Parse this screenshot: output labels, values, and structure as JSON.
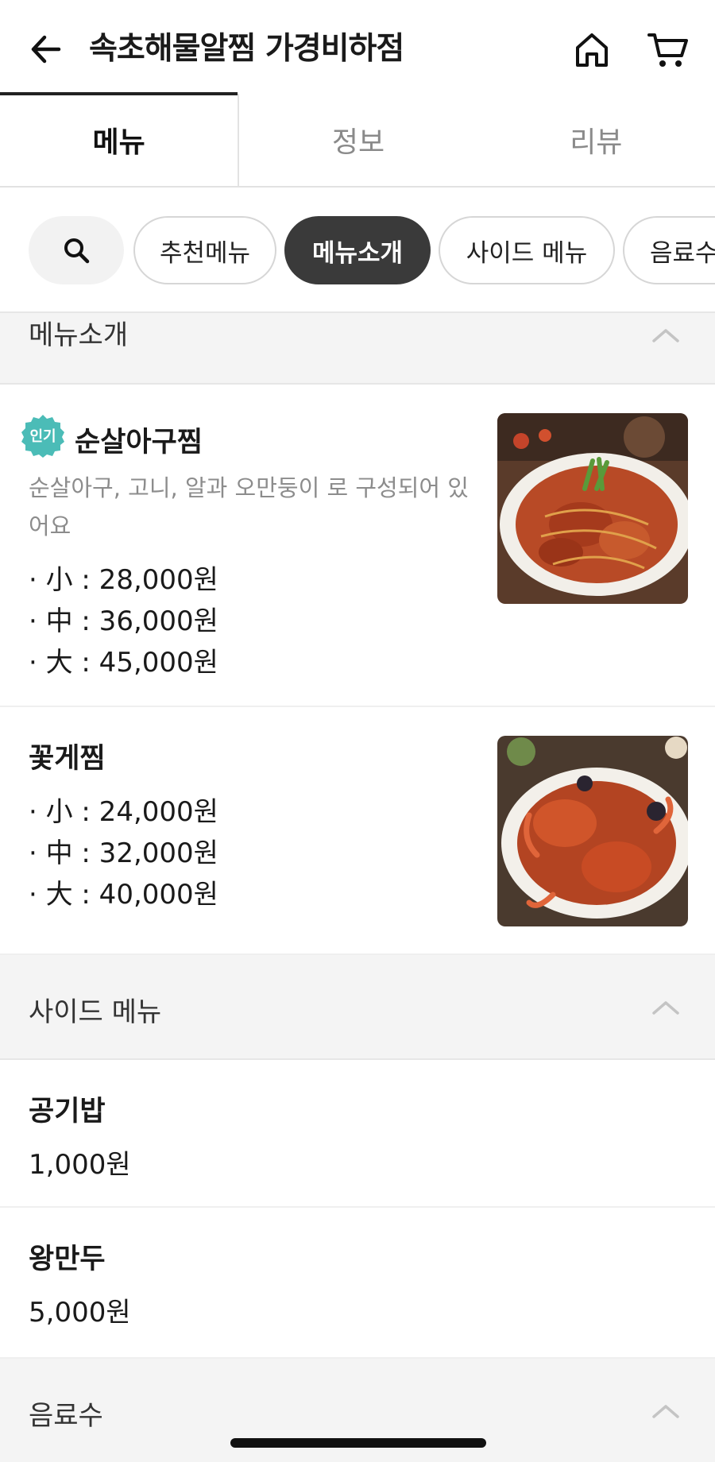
{
  "header": {
    "title": "속초해물알찜 가경비하점"
  },
  "tabs": [
    {
      "label": "메뉴"
    },
    {
      "label": "정보"
    },
    {
      "label": "리뷰"
    }
  ],
  "chips": [
    {
      "label": "추천메뉴"
    },
    {
      "label": "메뉴소개"
    },
    {
      "label": "사이드 메뉴"
    },
    {
      "label": "음료수"
    }
  ],
  "sections": {
    "intro": {
      "title": "메뉴소개"
    },
    "side": {
      "title": "사이드 메뉴"
    },
    "drinks": {
      "title": "음료수"
    }
  },
  "items": {
    "boneless_agu": {
      "badge": "인기",
      "name": "순살아구찜",
      "desc": "순살아구,  고니, 알과 오만둥이 로 구성되어 있어요",
      "prices": [
        "· 小 : 28,000원",
        "· 中 : 36,000원",
        "· 大 : 45,000원"
      ]
    },
    "crab": {
      "name": "꽃게찜",
      "prices": [
        "· 小 : 24,000원",
        "· 中 : 32,000원",
        "· 大 : 40,000원"
      ]
    },
    "rice": {
      "name": "공기밥",
      "price": "1,000원"
    },
    "dumpling": {
      "name": "왕만두",
      "price": "5,000원"
    }
  },
  "colors": {
    "active_chip": "#3a3a3a",
    "badge": "#4bbcb7",
    "section_bg": "#f4f4f4"
  },
  "icons": [
    "back-arrow-icon",
    "home-icon",
    "cart-icon",
    "search-icon",
    "chevron-up-icon"
  ]
}
